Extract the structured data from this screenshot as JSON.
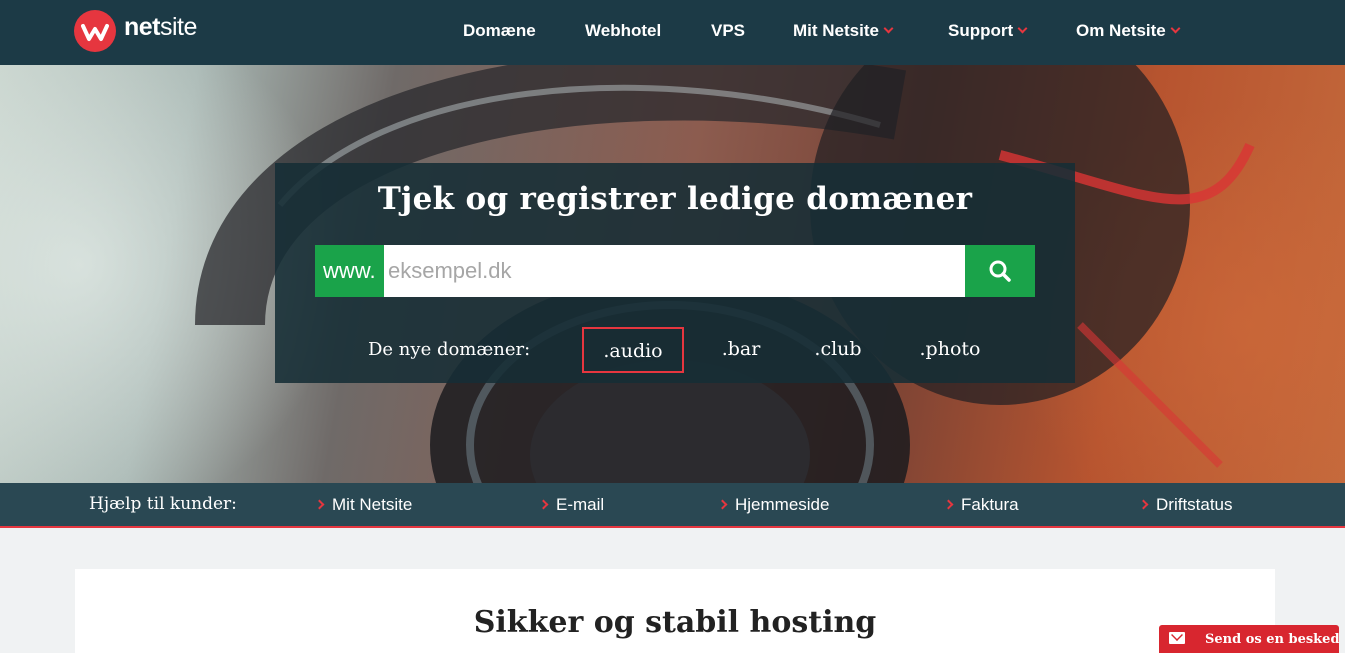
{
  "header": {
    "logo_text_bold": "net",
    "logo_text_light": "site",
    "nav": [
      {
        "label": "Domæne",
        "has_dropdown": false
      },
      {
        "label": "Webhotel",
        "has_dropdown": false
      },
      {
        "label": "VPS",
        "has_dropdown": false
      },
      {
        "label": "Mit Netsite",
        "has_dropdown": true
      },
      {
        "label": "Support",
        "has_dropdown": true
      },
      {
        "label": "Om Netsite",
        "has_dropdown": true
      }
    ]
  },
  "search": {
    "title": "Tjek og registrer ledige domæner",
    "prefix": "www.",
    "placeholder": "eksempel.dk",
    "value": "",
    "button_icon": "search-icon",
    "new_domains_label": "De nye domæner:",
    "tlds": [
      ".audio",
      ".bar",
      ".club",
      ".photo"
    ],
    "selected_tld": ".audio"
  },
  "help": {
    "label": "Hjælp til kunder:",
    "links": [
      "Mit Netsite",
      "E-mail",
      "Hjemmeside",
      "Faktura",
      "Driftstatus"
    ]
  },
  "content": {
    "title": "Sikker og stabil hosting"
  },
  "chat": {
    "icon": "envelope-icon",
    "label": "Send os en besked"
  },
  "colors": {
    "header_bg": "#1c3a46",
    "accent_red": "#e6363f",
    "accent_green": "#1aa34a",
    "helpbar_bg": "#2a4853"
  }
}
